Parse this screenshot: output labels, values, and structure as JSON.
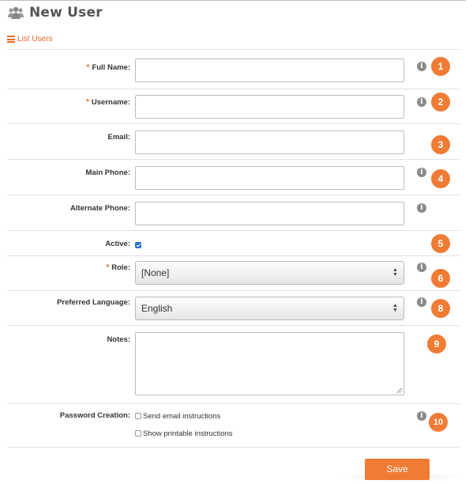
{
  "page": {
    "title": "New User",
    "list_link": "List Users"
  },
  "form": {
    "full_name": {
      "label": "Full Name:",
      "required_mark": "*",
      "value": "",
      "badge": "1",
      "info": "i"
    },
    "username": {
      "label": "Username:",
      "required_mark": "*",
      "value": "",
      "badge": "2",
      "info": "i"
    },
    "email": {
      "label": "Email:",
      "value": "",
      "badge": "3"
    },
    "main_phone": {
      "label": "Main Phone:",
      "value": "",
      "badge": "4",
      "info": "i"
    },
    "alternate_phone": {
      "label": "Alternate Phone:",
      "value": "",
      "info": "i"
    },
    "active": {
      "label": "Active:",
      "checked": true,
      "badge": "5"
    },
    "role": {
      "label": "Role:",
      "required_mark": "*",
      "selected": "[None]",
      "badge": "6",
      "info": "i"
    },
    "preferred_language": {
      "label": "Preferred Language:",
      "selected": "English",
      "badge": "8",
      "info": "i"
    },
    "notes": {
      "label": "Notes:",
      "value": "",
      "badge": "9"
    },
    "password_creation": {
      "label": "Password Creation:",
      "options": [
        "Send email instructions",
        "Show printable instructions"
      ],
      "badge": "10",
      "info": "i"
    }
  },
  "actions": {
    "save_label": "Save"
  },
  "colors": {
    "accent": "#f07b34",
    "link": "#e8692f",
    "info": "#8a8a8a",
    "checkbox": "#2c6fc8"
  },
  "icons": {
    "header": "users-icon",
    "list_link": "list-icon",
    "info": "info-icon",
    "select": "updown-arrows-icon"
  }
}
